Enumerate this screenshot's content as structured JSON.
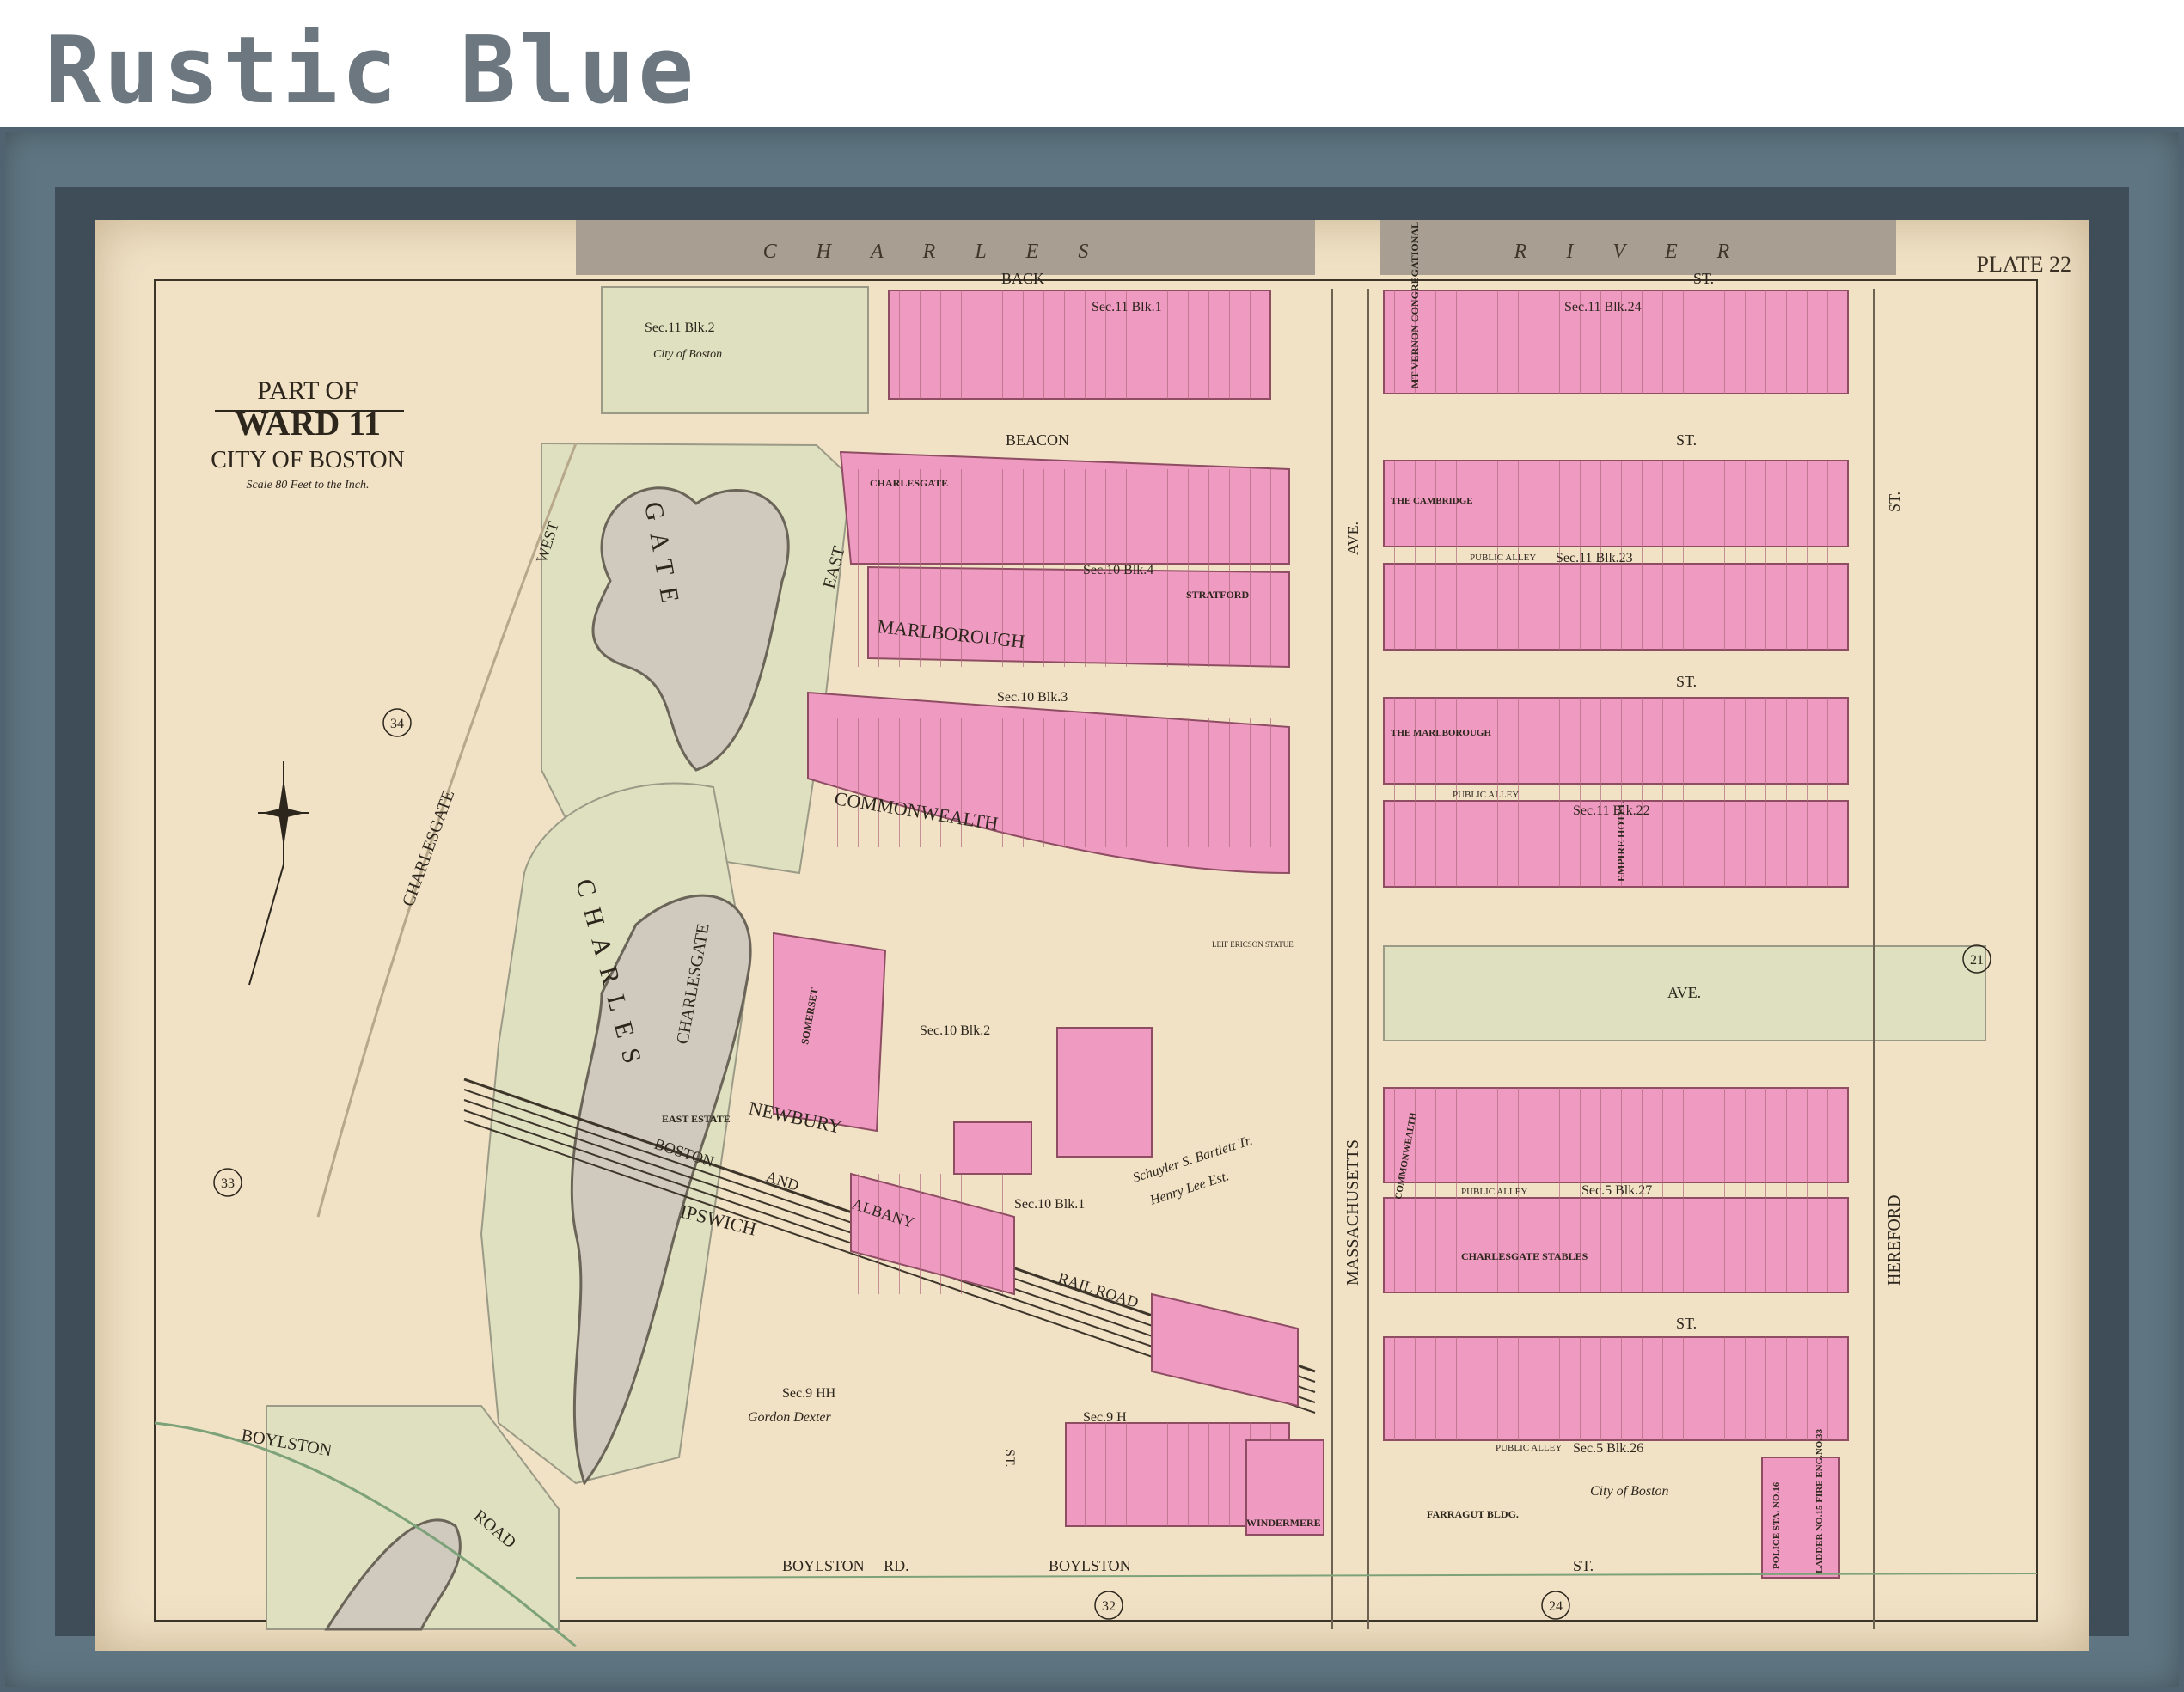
{
  "caption": "Rustic Blue",
  "map": {
    "plate": "PLATE 22",
    "title": {
      "line1": "PART OF",
      "line2": "WARD 11",
      "line3": "CITY OF BOSTON",
      "scale": "Scale 80 Feet to the Inch."
    },
    "water": {
      "left": "CHARLES",
      "right": "RIVER"
    },
    "streets": {
      "back": "BACK",
      "back_st": "ST.",
      "beacon": "BEACON",
      "beacon_st": "ST.",
      "marlborough": "MARLBOROUGH",
      "marlborough_st": "ST.",
      "commonwealth": "COMMONWEALTH",
      "commonwealth_ave": "AVE.",
      "newbury": "NEWBURY",
      "newbury_st": "ST.",
      "ipswich": "IPSWICH",
      "boylston": "BOYLSTON",
      "boylston_road": "ROAD",
      "boylston_rd": "BOYLSTON —RD.",
      "boylston_st": "BOYLSTON",
      "boylston_st2": "ST.",
      "east": "EAST",
      "west": "WEST",
      "charlesgate": "CHARLESGATE",
      "charlesgate_left": "CHARLESGATE",
      "charles_park": "CHARLES",
      "gate_park": "GATE",
      "massachusetts": "MASSACHUSETTS",
      "mass_ave": "AVE.",
      "hereford": "HEREFORD",
      "hereford_st": "ST.",
      "st_small": "ST.",
      "railroad1": "BOSTON",
      "railroad2": "AND",
      "railroad3": "ALBANY",
      "railroad4": "RAIL ROAD"
    },
    "blocks": {
      "b1": "Sec.11 Blk.2",
      "b2": "Sec.11 Blk.1",
      "b3": "Sec.11 Blk.24",
      "b4": "Sec.10 Blk.4",
      "b5": "Sec.11 Blk.23",
      "b6": "Sec.10 Blk.3",
      "b7": "Sec.11 Blk.22",
      "b8": "Sec.10 Blk.2",
      "b9": "Sec.5 Blk.27",
      "b10": "Sec.10 Blk.1",
      "b11": "Sec.9 HH",
      "b12": "Sec.9 H",
      "b13": "Sec.5 Blk.26"
    },
    "owners": {
      "o1": "City of Boston",
      "o2": "Gordon Dexter",
      "o3": "City of Boston",
      "o4": "Schuyler S. Bartlett Tr.",
      "o5": "Henry Lee Est."
    },
    "buildings": {
      "mt_vernon": "MT VERNON CONGREGATIONAL CHURCH",
      "charlesgate_bldg": "CHARLESGATE",
      "stratford": "STRATFORD",
      "cambridge": "THE CAMBRIDGE",
      "marlborough_bldg": "THE MARLBOROUGH",
      "empire": "EMPIRE HOTEL",
      "somerset": "SOMERSET",
      "commonwealth_bldg": "COMMONWEALTH",
      "charlesgate_stables": "CHARLESGATE STABLES",
      "farragut": "FARRAGUT BLDG.",
      "windermere": "WINDERMERE",
      "police": "POLICE STA. NO.16",
      "ladder": "LADDER NO.15 FIRE ENG.NO.33",
      "ericsson": "LEIF ERICSON STATUE",
      "east_estate": "EAST ESTATE"
    },
    "alleys": {
      "a1": "PUBLIC ALLEY",
      "a2": "PUBLIC ALLEY",
      "a3": "PUBLIC ALLEY",
      "a4": "PUBLIC ALLEY"
    },
    "plate_refs": {
      "p34": "34",
      "p33": "33",
      "p32": "32",
      "p24": "24",
      "p21": "21"
    }
  }
}
